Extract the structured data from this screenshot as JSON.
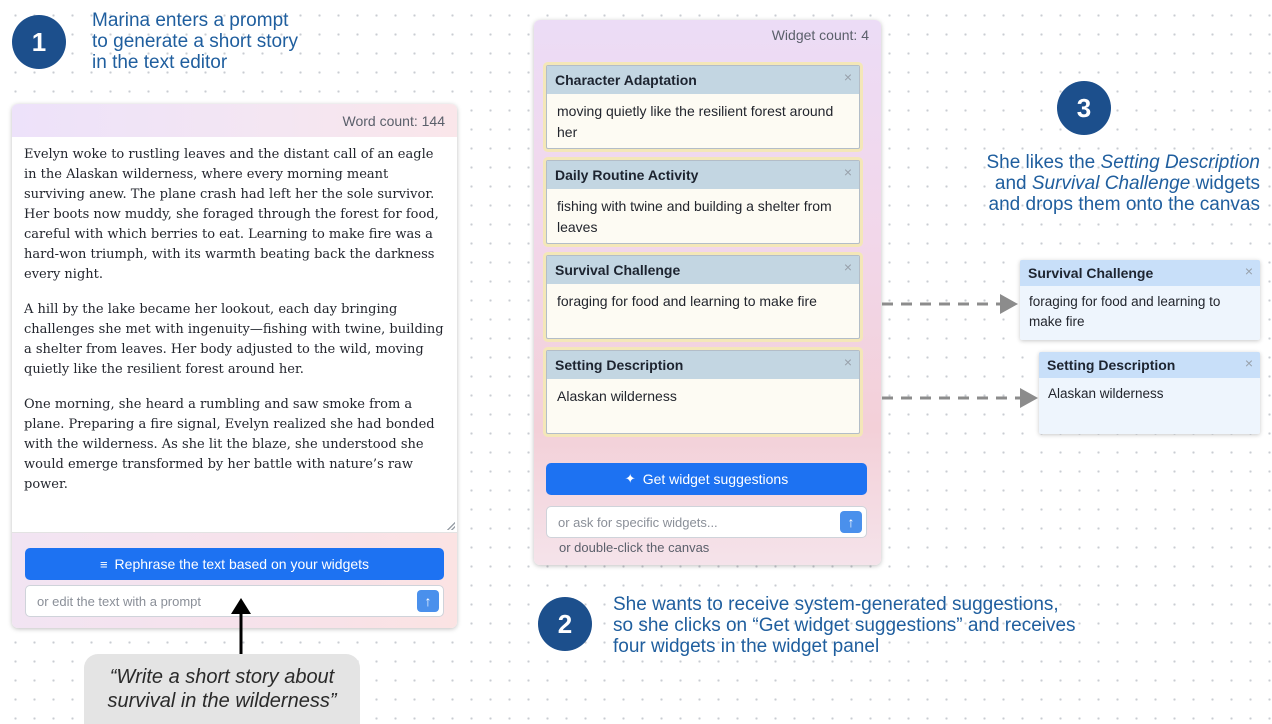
{
  "steps": {
    "one": {
      "num": "1",
      "caption_lines": [
        "Marina enters a prompt",
        "to generate a short story",
        "in the text editor"
      ]
    },
    "two": {
      "num": "2",
      "caption_lines": [
        "She wants to receive system-generated suggestions,",
        "so she clicks on “Get widget suggestions” and receives",
        "four widgets in the widget panel"
      ]
    },
    "three": {
      "num": "3",
      "caption_pre1": "She likes the ",
      "caption_em1": "Setting Description",
      "caption_pre2": "and ",
      "caption_em2": "Survival Challenge",
      "caption_post2": " widgets",
      "caption_line3": "and drops them onto the canvas"
    }
  },
  "editor": {
    "word_count": "Word count: 144",
    "paragraphs": [
      "Evelyn woke to rustling leaves and the distant call of an eagle in the Alaskan wilderness, where every morning meant surviving anew. The plane crash had left her the sole survivor. Her boots now muddy, she foraged through the forest for food, careful with which berries to eat. Learning to make fire was a hard-won triumph, with its warmth beating back the darkness every night.",
      "A hill by the lake became her lookout, each day bringing challenges she met with ingenuity—fishing with twine, building a shelter from leaves. Her body adjusted to the wild, moving quietly like the resilient forest around her.",
      "One morning, she heard a rumbling and saw smoke from a plane. Preparing a fire signal, Evelyn realized she had bonded with the wilderness. As she lit the blaze, she understood she would emerge transformed by her battle with nature’s raw power."
    ],
    "rephrase_label": "Rephrase the text based on your widgets",
    "prompt_placeholder": "or edit the text with a prompt"
  },
  "widget_panel": {
    "count": "Widget count: 4",
    "widgets": [
      {
        "title": "Character Adaptation",
        "body": "moving quietly like the resilient forest around her"
      },
      {
        "title": "Daily Routine Activity",
        "body": "fishing with twine and building a shelter from leaves"
      },
      {
        "title": "Survival Challenge",
        "body": "foraging for food and learning to make fire"
      },
      {
        "title": "Setting Description",
        "body": "Alaskan wilderness"
      }
    ],
    "suggest_label": "Get widget suggestions",
    "ask_placeholder": "or ask for specific widgets...",
    "hint": "or double-click the canvas"
  },
  "canvas_widgets": [
    {
      "title": "Survival Challenge",
      "body": "foraging for food and learning to make fire"
    },
    {
      "title": "Setting Description",
      "body": "Alaskan wilderness"
    }
  ],
  "quote": {
    "line1": "“Write a short story about",
    "line2": "survival in the wilderness”"
  },
  "icons": {
    "close": "×",
    "send": "↑",
    "rephrase": "≡",
    "sparkle": "✦"
  },
  "colors": {
    "accent": "#1d72f2",
    "step": "#1c4f8c",
    "caption": "#1f5e9e"
  }
}
